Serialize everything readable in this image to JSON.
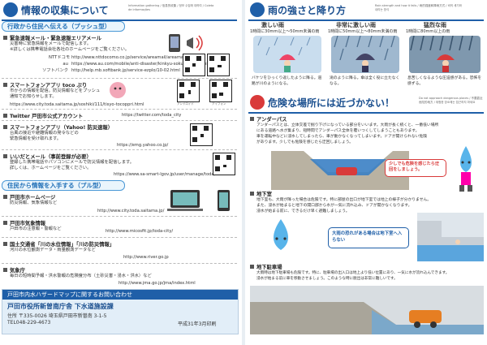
{
  "left": {
    "header": {
      "title": "情報の収集について",
      "subtitle_en": "Information gathering / 信息的收集 / 정보 수집에 대하여 / Coleta de informações"
    },
    "band_push": {
      "label": "行政から住民へ伝える（プッシュ型）"
    },
    "band_pull": {
      "label": "住民から情報を入手する（プル型）"
    },
    "emergency_mail": {
      "title": "緊急速報メール・緊急速報エリアメール",
      "desc1": "災害時に緊急情報をメールで配信します。",
      "desc2": "※詳しくは携帯電話会社各社のホームページをご覧ください。",
      "carriers": [
        {
          "name": "NTTドコモ",
          "url": "http://www.nttdocomo.co.jp/service/areamail/areamail_app/"
        },
        {
          "name": "au",
          "url": "https://www.au.com/mobile/anti-disaster/kinkyu-sokuho/saigai-hinan/"
        },
        {
          "name": "ソフトバンク",
          "url": "http://help.mb.softbank.jp/service-ezplo/10-02.html"
        }
      ]
    },
    "toco_app": {
      "title": "スマートフォンアプリ toco ぷり",
      "desc1": "市からの情報を配信。防災情報などをプッシュ",
      "desc2": "通知でお知らせします。",
      "url": "https://www.city.toda.saitama.jp/soshiki/111/tisyo-tocoppri.html",
      "caption_android": "アンドロイド",
      "caption_ios": "アイフォン"
    },
    "twitter": {
      "title": "Twitter 戸田市公式アカウント",
      "url": "https://twitter.com/toda_city"
    },
    "yahoo_app": {
      "title": "スマートフォンアプリ（Yahoo! 防災速報）",
      "desc1": "台風の接近や避難情報の発令などの",
      "desc2": "緊急情報を受け取れます。",
      "url": "https://emg.yahoo.co.jp/"
    },
    "itsudemo_mail": {
      "title": "いいだとメール（事前登録が必要）",
      "desc1": "登録した携帯電話やパソコンにメールで防災情報を配信します。",
      "desc2": "詳しくは、ホームページをご覧ください。",
      "url": "https://www.sa-smart-lgov.jp/user/manage/toda/"
    },
    "city_homepage": {
      "title": "戸田市ホームページ",
      "desc": "防災情報、気象情報など",
      "url": "http://www.city.toda.saitama.jp/"
    },
    "weather_station": {
      "title": "戸田市気象情報",
      "desc": "戸田市の注意報・警報など",
      "url": "http://www.micosfit.jp/toda-city/"
    },
    "mlit": {
      "title": "国土交通省「川の水位情報」「川の防災情報」",
      "desc": "河川の水位観測データ・雨量観測データなど",
      "url": "http://www.river.go.jp"
    },
    "jma": {
      "title": "気象庁",
      "desc": "毎日の短時間予報・洪水警報の危険度分布（土砂災害・浸水・洪水）など",
      "url": "http://www.jma.go.jp/jma/index.html"
    },
    "contact": {
      "header": "戸田市内水ハザードマップに関するお問い合わせ",
      "office": "戸田市役所新曽南庁舎 下水道施設課",
      "address": "住所 〒335-0026 埼玉県戸田市新曽南 3-1-5",
      "tel": "TEL048-229-4673",
      "date": "平成31年3月印刷"
    }
  },
  "right": {
    "rain_header": {
      "title": "雨の強さと降り方",
      "subtitle_en": "Rain strength and how it falls / 雨的强度和降雨方式 / 비의 세기와 내리는 방식"
    },
    "rain_levels": [
      {
        "name": "激しい雨",
        "range": "1時間に30mm以上〜50mm未満の雨",
        "desc": "バケツをひっくり返したように降る。道路が川のようになる。"
      },
      {
        "name": "非常に激しい雨",
        "range": "1時間に50mm以上〜80mm未満の雨",
        "desc": "滝のように降る。傘は全く役に立たなくなる。"
      },
      {
        "name": "猛烈な雨",
        "range": "1時間に80mm以上の雨",
        "desc": "息苦しくなるような圧迫感がある。恐怖を感ずる。"
      }
    ],
    "danger_header": {
      "title": "危険な場所には近づかない！",
      "subtitle_en": "Do not approach dangerous places / 不要靠近危险的地方 / 위험한 장소에는 접근하지 마세요"
    },
    "underpass": {
      "title": "アンダーパス",
      "desc1": "アンダーパスとは、立体交差で掘り下げになっている部分をいいます。大雨が長く続くと、一番低い場所",
      "desc2": "にある道路へ水が集まり、短時間でアンダーパス全体を覆いつくしてしまうこともあります。",
      "desc3": "車を運転中などに浸水してしまったら、車が動かなくなってしまいます。ドアが開けられない危険",
      "desc4": "があります。少しでも危険を感じたら迂回しましょう。",
      "bubble": "少しでも危険を感じたら迂回をしましょう。"
    },
    "underground": {
      "title": "地下室",
      "desc1": "地下室も、大雨が降った場合は危険です。特に部屋の出口が地下室では地上の様子が分かりません。",
      "desc2": "また、浸水が始まると地下の開口部から水が一気に流れ込み、ドアが開かなくなります。",
      "desc3": "浸水が始まる前に、できるだけ早く避難しましょう。",
      "bubble": "大雨の恐れがある場合は地下室へ入らない"
    },
    "parking": {
      "title": "地下駐車場",
      "desc1": "大雨時は地下駐車場も危険です。特に、駐車場の出入口は地上より低い位置にあり、一気に水が流れ込んできます。",
      "desc2": "浸水が始まる前に車を移動させましょう。このような時に脱出は非常に難しいです。"
    }
  },
  "colors": {
    "accent": "#1f5fa8",
    "band_border": "#4a98d6",
    "band_bg": "#eaf5fc",
    "warning_red": "#d93a3a"
  }
}
